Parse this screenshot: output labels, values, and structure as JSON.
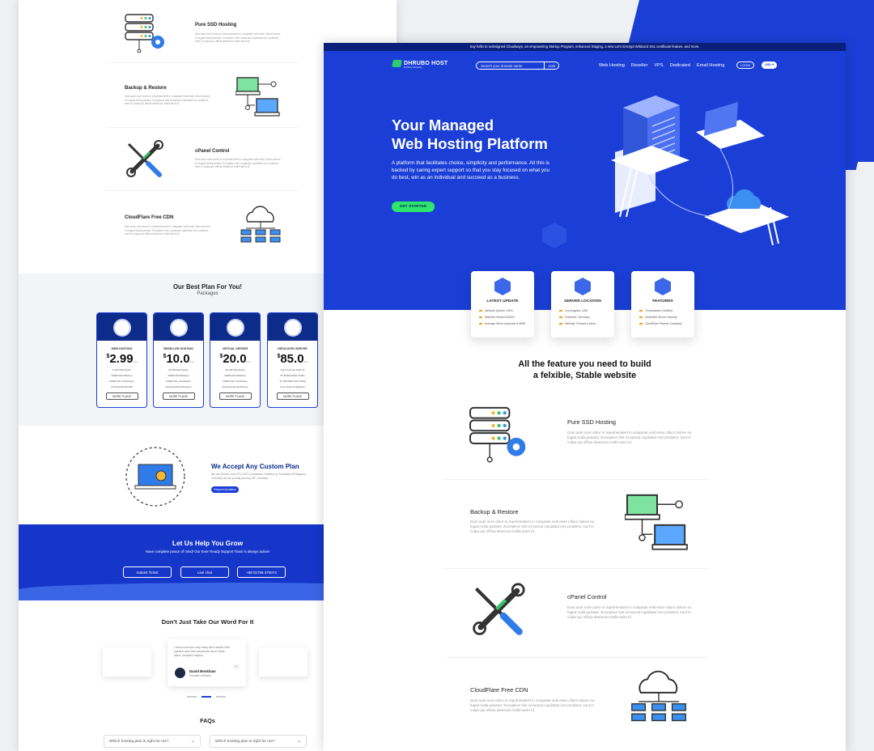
{
  "announcement": "Say hello to redesigned Cloudways, an empowering Startup Program, enhanced Staging, a new Let's Encrypt Wildcard SSL certificate feature, and more.",
  "brand": {
    "name": "DHRUBO HOST",
    "tagline": "Hosting Company",
    "accent": "#1b3fd6",
    "green": "#2ee66b",
    "navy": "#0a1f7a"
  },
  "header": {
    "search_placeholder": "Search your domain name",
    "domain_ext": ".com",
    "nav": [
      "Web Hosting",
      "Reseller",
      "VPS",
      "Dedicated",
      "Email Hosting"
    ],
    "login": "LOGIN",
    "currency": "USD ▾"
  },
  "hero": {
    "title_line1": "Your Managed",
    "title_line2": "Web Hosting Platform",
    "desc": "A platform that facilitates choice, simplicity and performance. All this is backed by caring expert support so that you stay focused on what you do best, win as an individual and succeed as a business.",
    "cta": "GET STARTED"
  },
  "info_cards": [
    {
      "title": "LATEST UPDATE",
      "items": [
        "Network Uptime 100%",
        "Website Hosted 40000+",
        "Average Sever response 6 MMS"
      ]
    },
    {
      "title": "SERVER LOCATION",
      "items": [
        "Los Angeles, USA",
        "Frankfurt, Germany",
        "Helsinki, Finland & More"
      ]
    },
    {
      "title": "FEATURES",
      "items": [
        "Trustedwave Certified",
        "Hurify360 Server Security",
        "CloudFlare Partner Company"
      ]
    }
  ],
  "features_heading_line1": "All the feature you need to build",
  "features_heading_line2": "a felxible, Stable website",
  "lorem": "Duis aute irure dolor in reprehenderit in voluptate velit esse cillum dolore eu fugiat nulla pariatur. Excepteur sint occaecat cupidatat non proident, sunt in culpa qui officia deserunt mollit anim id.",
  "features": [
    {
      "title": "Pure SSD Hosting",
      "icon": "server-icon"
    },
    {
      "title": "Backup & Restore",
      "icon": "backup-icon"
    },
    {
      "title": "cPanel Control",
      "icon": "tools-icon"
    },
    {
      "title": "CloudFlare Free CDN",
      "icon": "cloud-cdn-icon"
    }
  ],
  "plans": {
    "heading": "Our Best Plan For You!",
    "sub": "Packages",
    "more": "MORE PLANS",
    "cards": [
      {
        "name": "WEB HOSTING",
        "price": "2.99",
        "l1": "1 GB SSD Space",
        "l2": "FREE Web Backup",
        "l3": "FREE SSL Certificates",
        "l4": "Unlimited Bandwidth"
      },
      {
        "name": "RESELLER HOSTING",
        "price": "10.0",
        "l1": "25 GB Disk Space",
        "l2": "FREE Web Backup",
        "l3": "FREE SSL Certificates",
        "l4": "Unlimited Email Delivery"
      },
      {
        "name": "VIRTUAL SERVER",
        "price": "20.0",
        "l1": "25 GB Disk Space",
        "l2": "FREE Web Backup",
        "l3": "FREE SSL Certificates",
        "l4": "Unlimited Email Delivery"
      },
      {
        "name": "DEDICATED SERVER",
        "price": "85.0",
        "l1": "Intel Xeon E3-1230 v2",
        "l2": "8 TB Bandwidth Traffic",
        "l3": "32 GB DDR4 ECC RAM",
        "l4": "Free Setup & Migration"
      }
    ]
  },
  "custom": {
    "title": "We Accept Any Custom Plan",
    "desc": "We are Dhrubo Host PCI DSS Compliance Certified by Trustwave Pentagonic. Currently we are proudly serving 40+ countries.",
    "btn": "Request Quotation"
  },
  "grow": {
    "title": "Let Us Help You Grow",
    "sub": "Have complete peace of mind! Our Ever Ready Support Team is always active!",
    "b1": "Submit Ticket",
    "b2": "Live chat",
    "b3": "+88 01755 470074"
  },
  "testimonials": {
    "heading": "Don't Just Take Our Word For It",
    "quote": "I found service very easy and hassle free system and lots resources and I think other vendors helpful.",
    "name": "David Beckham",
    "role": "Founder of Brand"
  },
  "faq": {
    "heading": "FAQs",
    "q1": "Which hosting plan is right for me?",
    "q2": "Which hosting plan is right for me?"
  }
}
